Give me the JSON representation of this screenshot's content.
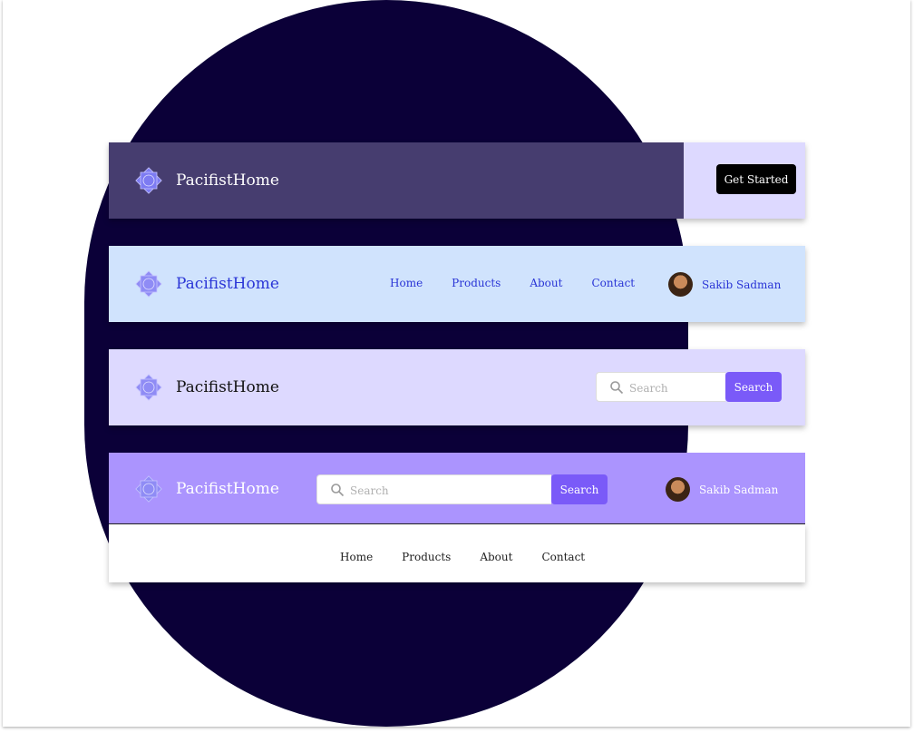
{
  "brand": {
    "name": "PacifistHome"
  },
  "bar1": {
    "cta_label": "Get Started"
  },
  "bar2": {
    "nav": [
      "Home",
      "Products",
      "About",
      "Contact"
    ],
    "user_name": "Sakib Sadman"
  },
  "bar3": {
    "search_placeholder": "Search",
    "search_button": "Search"
  },
  "bar4": {
    "search_placeholder": "Search",
    "search_button": "Search",
    "user_name": "Sakib Sadman",
    "nav": [
      "Home",
      "Products",
      "About",
      "Contact"
    ]
  },
  "colors": {
    "blob": "#0b0038",
    "bar1_bg": "#ddd9ff",
    "bar2_bg": "#d0e3fd",
    "bar3_bg": "#ddd9ff",
    "bar4_bg": "#ab94fe",
    "accent": "#7a5af8",
    "link_blue": "#2a35d6"
  },
  "icons": [
    "lotus-logo-icon",
    "search-icon",
    "avatar"
  ]
}
